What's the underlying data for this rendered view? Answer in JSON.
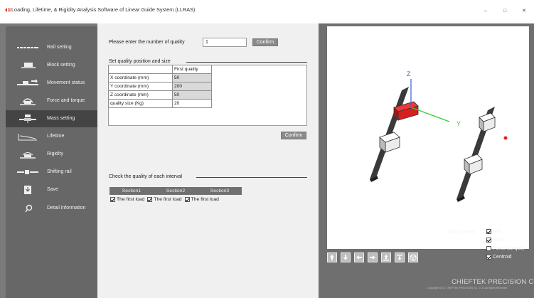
{
  "window": {
    "title": "Loading, Lifetime, & Rigidity Analysis Software of Linear Guide System (LLRAS)",
    "minimize_glyph": "–",
    "maximize_glyph": "□",
    "close_glyph": "✕"
  },
  "sidebar": {
    "items": [
      {
        "label": "Rail setting",
        "icon": "rail-icon"
      },
      {
        "label": "Block setting",
        "icon": "block-icon"
      },
      {
        "label": "Movement status",
        "icon": "movement-icon"
      },
      {
        "label": "Force and torque",
        "icon": "force-icon"
      },
      {
        "label": "Mass setting",
        "icon": "mass-icon",
        "active": true
      },
      {
        "label": "Lifetime",
        "icon": "lifetime-icon"
      },
      {
        "label": "Rigidity",
        "icon": "rigidity-icon"
      },
      {
        "label": "Shifting rail",
        "icon": "shifting-rail-icon"
      },
      {
        "label": "Save",
        "icon": "save-icon"
      },
      {
        "label": "Detail information",
        "icon": "search-icon"
      }
    ]
  },
  "form": {
    "quality_count_label": "Please enter the number of quality",
    "quality_count_value": "1",
    "confirm_label": "Confirm",
    "position_group_title": "Set quality position and size",
    "table": {
      "column_header": "First quality",
      "rows": [
        {
          "label": "X coordinate (mm)",
          "value": "50"
        },
        {
          "label": "Y coordinate (mm)",
          "value": "200"
        },
        {
          "label": "Z coordinate (mm)",
          "value": "50"
        },
        {
          "label": "quality size (Kg)",
          "value": "20"
        }
      ]
    },
    "confirm2_label": "Confirm",
    "interval_group_title": "Check the quality of each interval",
    "sections": [
      "Section1",
      "Section2",
      "Section3"
    ],
    "section_checks": [
      {
        "label": "The first load",
        "checked": true
      },
      {
        "label": "The first load",
        "checked": true
      },
      {
        "label": "The first load",
        "checked": true
      }
    ]
  },
  "viewer": {
    "axis_z": "Z",
    "axis_y": "Y",
    "display_items_label": "Display items",
    "display_items": [
      {
        "label": "Rail",
        "checked": true
      },
      {
        "label": "Block",
        "checked": true
      },
      {
        "label": "Force (torque)",
        "checked": false
      },
      {
        "label": "Centroid",
        "checked": true
      }
    ],
    "toolbar_icons": [
      "arrow-up-icon",
      "arrow-down-icon",
      "arrow-left-icon",
      "arrow-right-icon",
      "rotate-up-icon",
      "rotate-down-icon",
      "cube-icon"
    ],
    "brand": "CHIEFTEK PRECISION CO., LTD.",
    "copyright": "Copyright©2017 CHIEFTEK PRECISION CO., LTD. All Rights Reserved."
  },
  "colors": {
    "sidebar_bg": "#676767",
    "sidebar_active": "#444444",
    "form_bg": "#f0f0f0",
    "right_bg": "#6f6f6f",
    "selected_block": "#d62020",
    "axis_green": "#33cc33",
    "axis_blue": "#3a5fd0",
    "centroid": "#e02020"
  }
}
